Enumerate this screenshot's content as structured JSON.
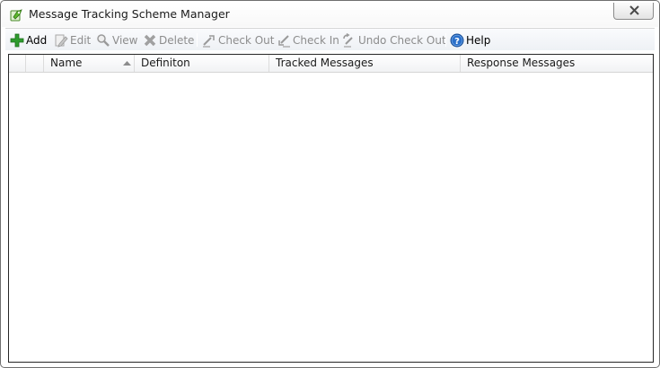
{
  "window": {
    "title": "Message Tracking Scheme Manager",
    "app_icon": "tracking-scheme-icon"
  },
  "toolbar": {
    "add_label": "Add",
    "edit_label": "Edit",
    "view_label": "View",
    "delete_label": "Delete",
    "check_out_label": "Check Out",
    "check_in_label": "Check In",
    "undo_check_out_label": "Undo Check Out",
    "help_label": "Help"
  },
  "grid": {
    "columns": [
      "",
      "Name",
      "Definiton",
      "Tracked Messages",
      "Response Messages"
    ],
    "sort_column": "Name",
    "sort_direction": "ascending",
    "rows": []
  },
  "colors": {
    "add_green": "#2e9b2e",
    "help_blue": "#2a6fc9",
    "disabled_text": "#8c8c8c"
  }
}
